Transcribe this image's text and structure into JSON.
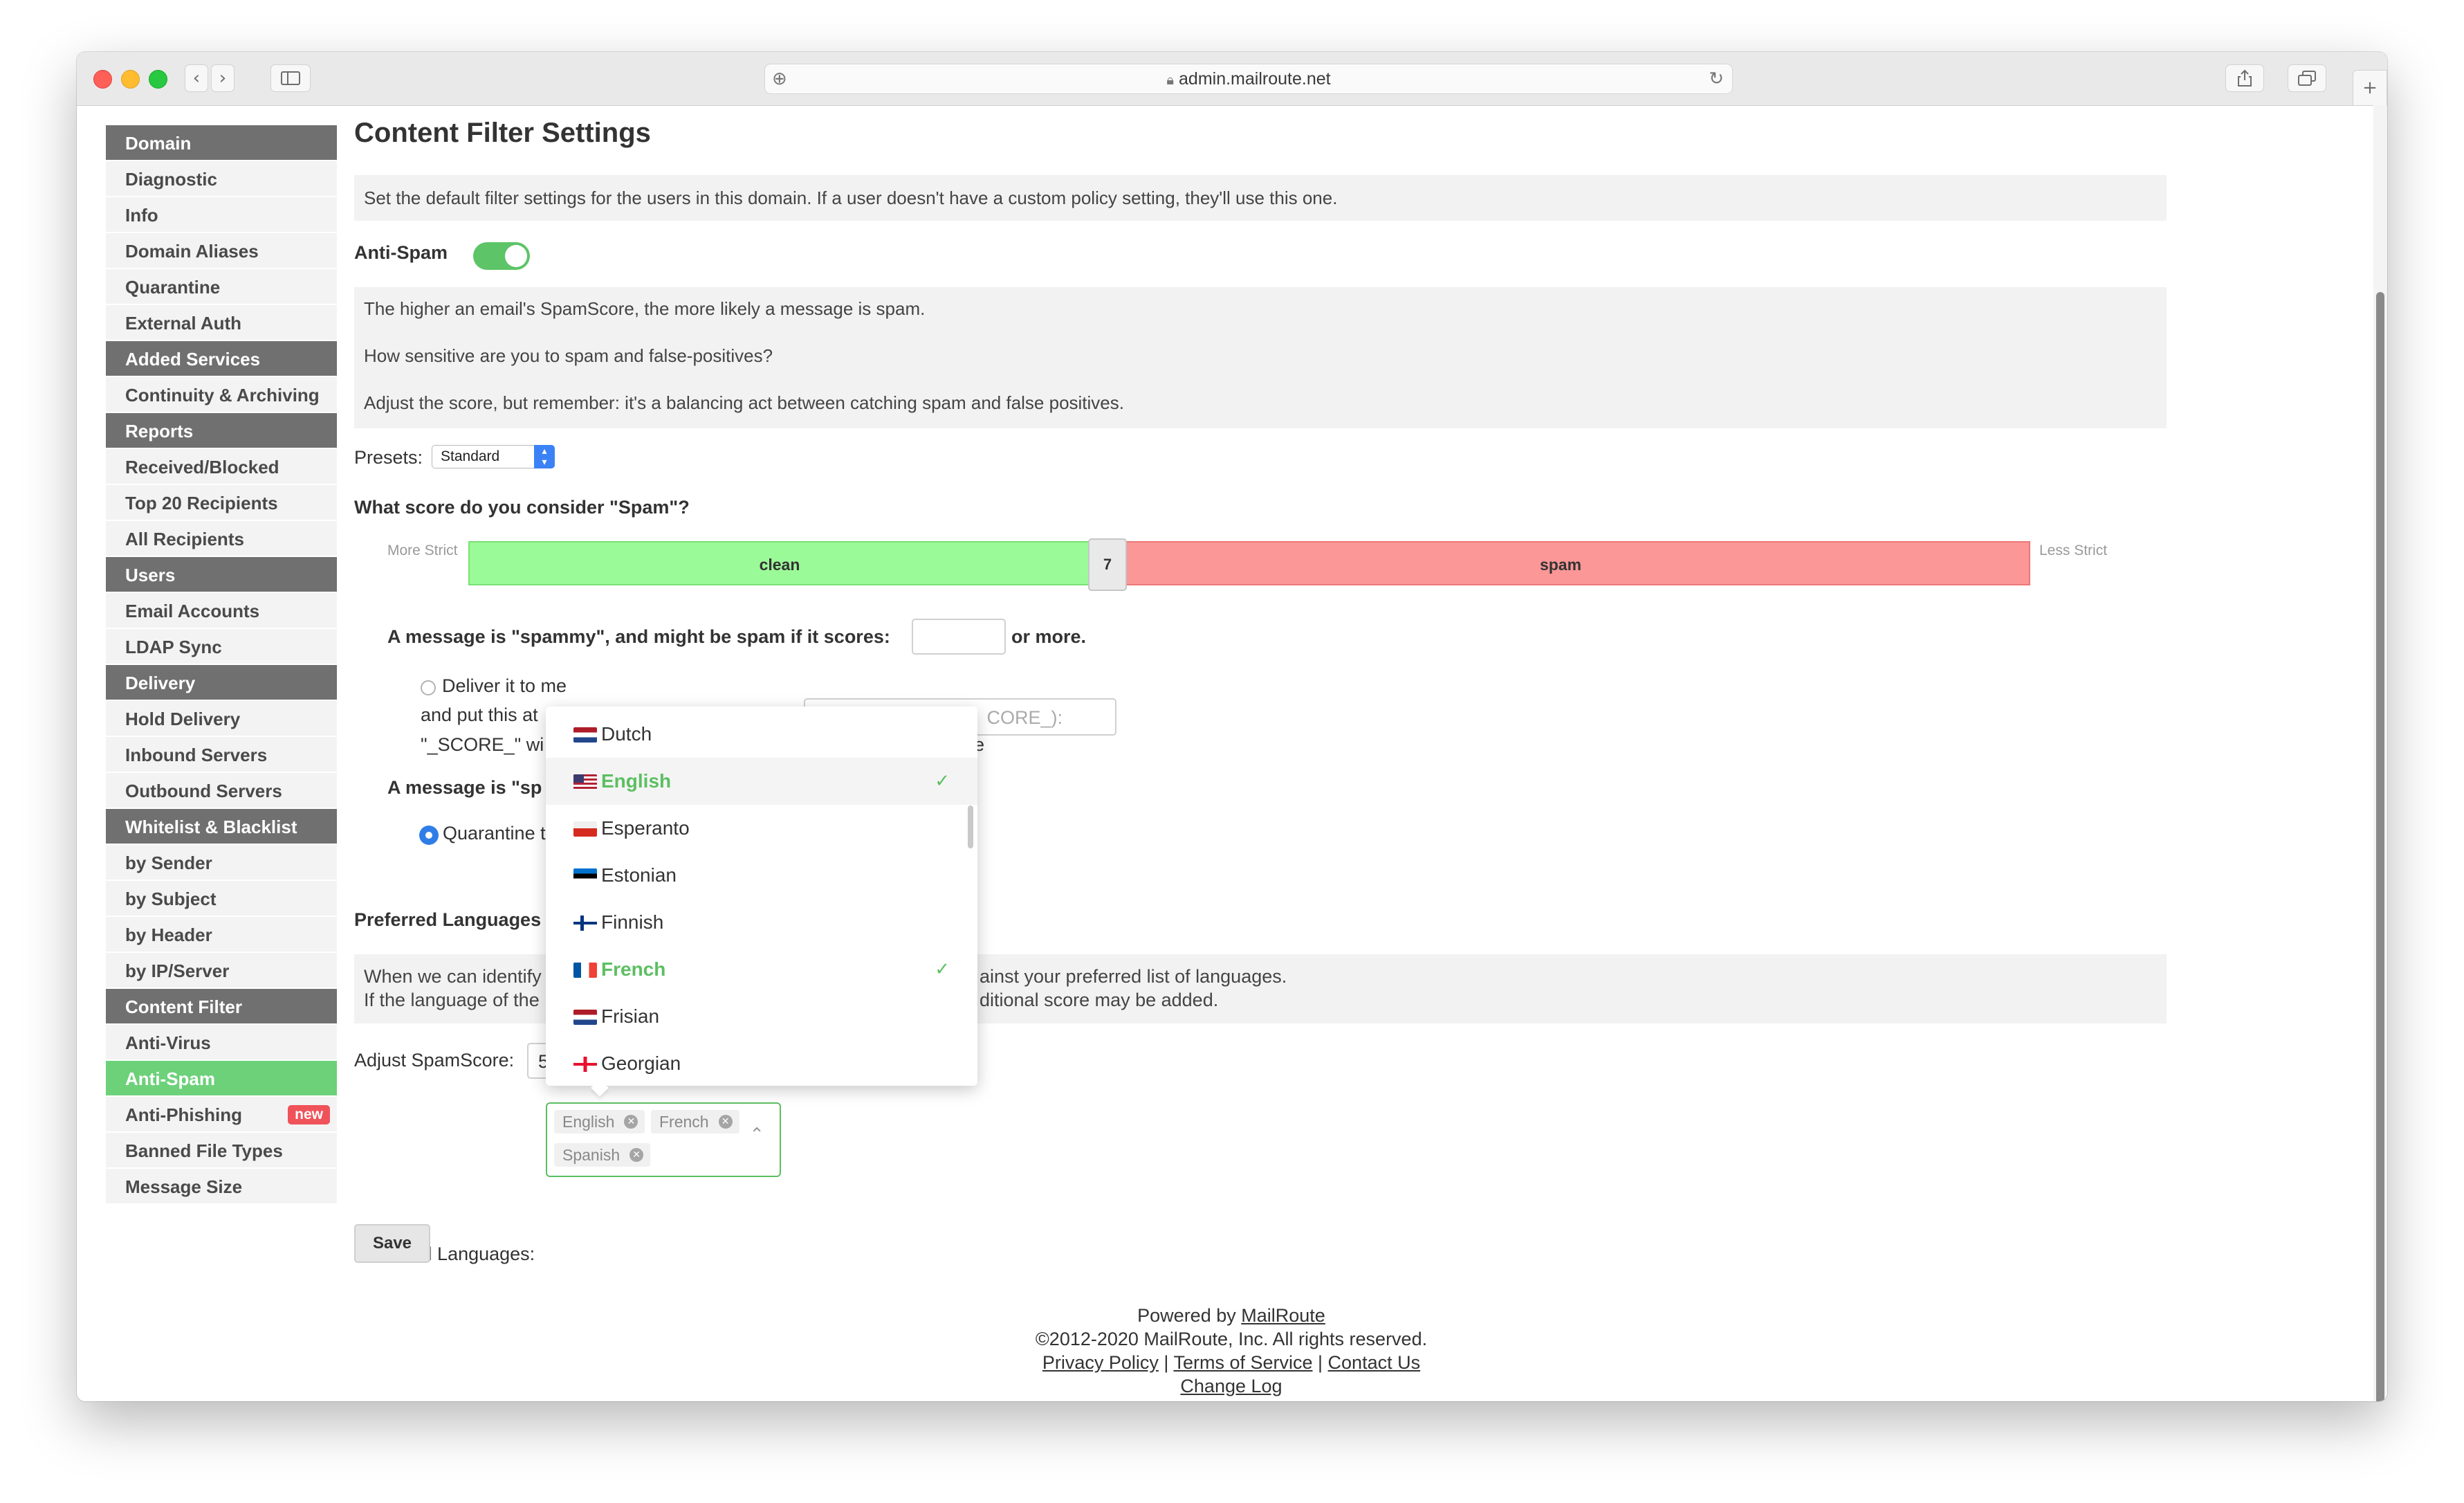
{
  "browser": {
    "url": "admin.mailroute.net"
  },
  "sidebar": {
    "items": [
      {
        "label": "Domain",
        "type": "section"
      },
      {
        "label": "Diagnostic",
        "type": "link"
      },
      {
        "label": "Info",
        "type": "link"
      },
      {
        "label": "Domain Aliases",
        "type": "link"
      },
      {
        "label": "Quarantine",
        "type": "link"
      },
      {
        "label": "External Auth",
        "type": "link"
      },
      {
        "label": "Added Services",
        "type": "section"
      },
      {
        "label": "Continuity & Archiving",
        "type": "link"
      },
      {
        "label": "Reports",
        "type": "section"
      },
      {
        "label": "Received/Blocked",
        "type": "link"
      },
      {
        "label": "Top 20 Recipients",
        "type": "link"
      },
      {
        "label": "All Recipients",
        "type": "link"
      },
      {
        "label": "Users",
        "type": "section"
      },
      {
        "label": "Email Accounts",
        "type": "link"
      },
      {
        "label": "LDAP Sync",
        "type": "link"
      },
      {
        "label": "Delivery",
        "type": "section"
      },
      {
        "label": "Hold Delivery",
        "type": "link"
      },
      {
        "label": "Inbound Servers",
        "type": "link"
      },
      {
        "label": "Outbound Servers",
        "type": "link"
      },
      {
        "label": "Whitelist & Blacklist",
        "type": "section"
      },
      {
        "label": "by Sender",
        "type": "link"
      },
      {
        "label": "by Subject",
        "type": "link"
      },
      {
        "label": "by Header",
        "type": "link"
      },
      {
        "label": "by IP/Server",
        "type": "link"
      },
      {
        "label": "Content Filter",
        "type": "section"
      },
      {
        "label": "Anti-Virus",
        "type": "link"
      },
      {
        "label": "Anti-Spam",
        "type": "active"
      },
      {
        "label": "Anti-Phishing",
        "type": "link",
        "badge": "new"
      },
      {
        "label": "Banned File Types",
        "type": "link"
      },
      {
        "label": "Message Size",
        "type": "link"
      }
    ]
  },
  "main": {
    "title": "Content Filter Settings",
    "intro": "Set the default filter settings for the users in this domain. If a user doesn't have a custom policy setting, they'll use this one.",
    "antispam_label": "Anti-Spam",
    "antispam_enabled": true,
    "info_lines": [
      "The higher an email's SpamScore, the more likely a message is spam.",
      "How sensitive are you to spam and false-positives?",
      "Adjust the score, but remember: it's a balancing act between catching spam and false positives."
    ],
    "presets_label": "Presets:",
    "presets_value": "Standard",
    "score_question": "What score do you consider \"Spam\"?",
    "slider": {
      "left_label": "More Strict",
      "right_label": "Less Strict",
      "clean_label": "clean",
      "spam_label": "spam",
      "value": "7"
    },
    "spammy_prefix": "A message is \"spammy\", and might be spam if it scores:",
    "spammy_suffix": "or more.",
    "deliver_label": "Deliver it to me",
    "put_this_label": "and put this at",
    "subject_placeholder_tail": "CORE_):",
    "score_line_label": "\"_SCORE_\" wi",
    "score_line_tail": "e",
    "spam_prefix": "A message is \"sp",
    "quarantine_label": "Quarantine t",
    "pref_lang_heading": "Preferred Languages",
    "pref_info_line1_start": "When we can identify",
    "pref_info_line1_end": "ainst your preferred list of languages.",
    "pref_info_line2_start": "If the language of the",
    "pref_info_line2_end": "ditional score may be added.",
    "adjust_label": "Adjust SpamScore:",
    "adjust_value": "5",
    "pref_lang_label": "Preferred Languages:",
    "selected_languages": [
      "English",
      "French",
      "Spanish"
    ],
    "save_label": "Save"
  },
  "language_dropdown": {
    "options": [
      {
        "name": "Dutch",
        "selected": false,
        "flag": "nl"
      },
      {
        "name": "English",
        "selected": true,
        "flag": "us"
      },
      {
        "name": "Esperanto",
        "selected": false,
        "flag": "eo"
      },
      {
        "name": "Estonian",
        "selected": false,
        "flag": "ee"
      },
      {
        "name": "Finnish",
        "selected": false,
        "flag": "fi"
      },
      {
        "name": "French",
        "selected": true,
        "flag": "fr"
      },
      {
        "name": "Frisian",
        "selected": false,
        "flag": "nl"
      },
      {
        "name": "Georgian",
        "selected": false,
        "flag": "ge"
      }
    ],
    "check_glyph": "✓"
  },
  "footer": {
    "powered_by": "Powered by",
    "powered_link": "MailRoute",
    "copyright": "©2012-2020 MailRoute, Inc. All rights reserved.",
    "links": [
      "Privacy Policy",
      "Terms of Service",
      "Contact Us"
    ],
    "separator": " | ",
    "changelog": "Change Log"
  },
  "colors": {
    "accent_green": "#5cbf62",
    "clean_green": "#9bfa98",
    "spam_red": "#fb9797",
    "sidebar_section": "#707070",
    "new_badge": "#f0525a"
  }
}
